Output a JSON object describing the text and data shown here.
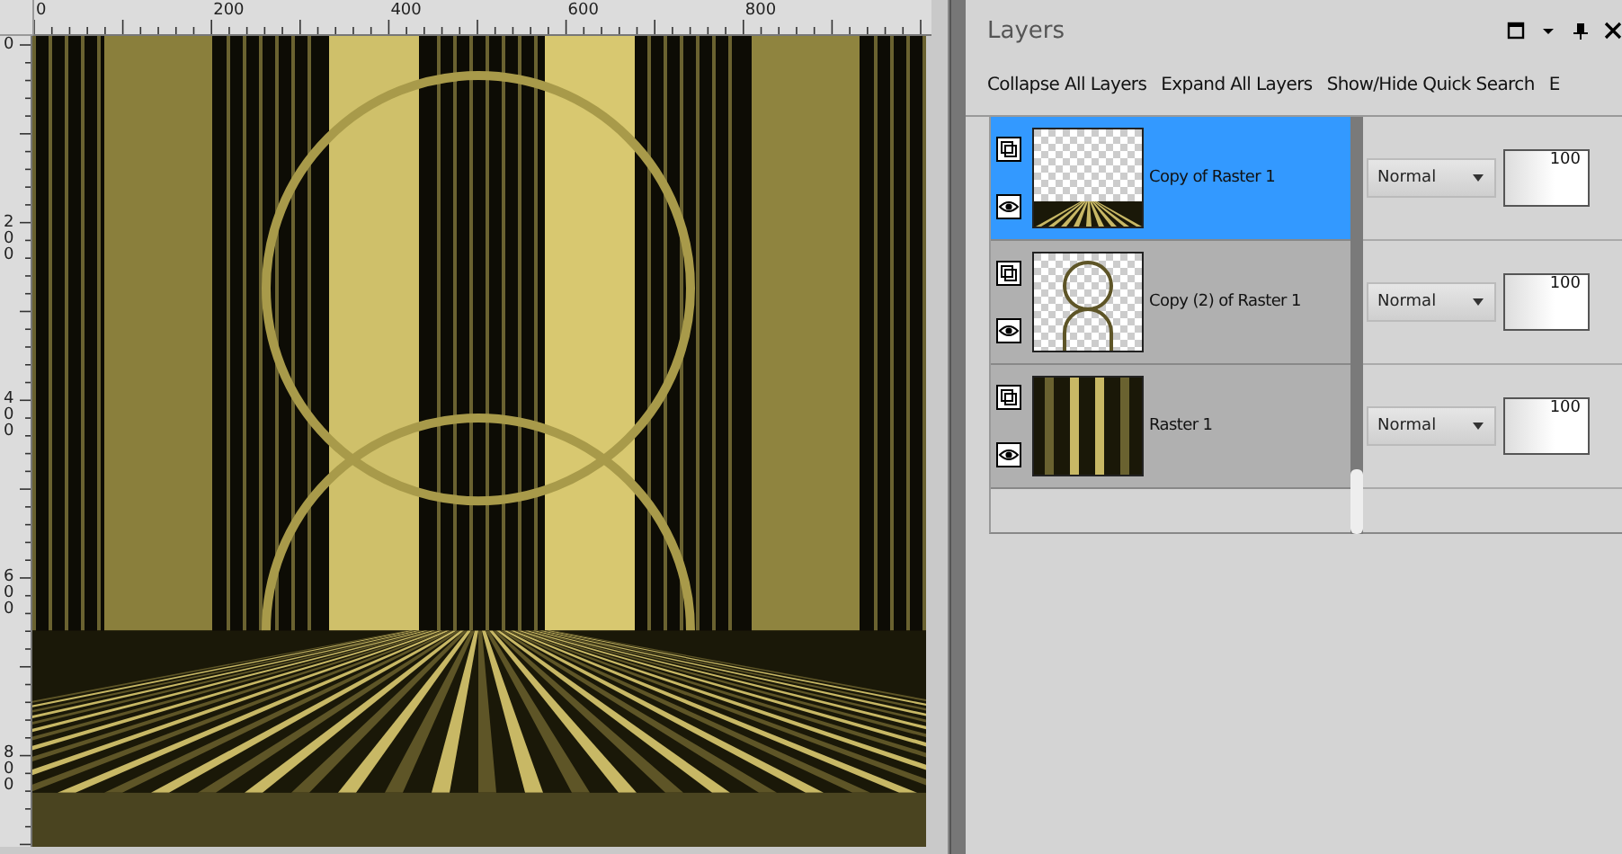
{
  "rulers": {
    "horizontal": [
      "0",
      "200",
      "400",
      "600",
      "800"
    ],
    "vertical": [
      "0",
      "200",
      "400",
      "600",
      "800"
    ]
  },
  "layers_panel": {
    "title": "Layers",
    "toolbar": [
      "Collapse All Layers",
      "Expand All Layers",
      "Show/Hide Quick Search",
      "E"
    ],
    "layers": [
      {
        "name": "Copy of Raster 1",
        "selected": true,
        "visible": true,
        "kind": "floor",
        "blend_mode": "Normal",
        "opacity": "100"
      },
      {
        "name": "Copy (2) of Raster 1",
        "selected": false,
        "visible": true,
        "kind": "rings",
        "blend_mode": "Normal",
        "opacity": "100"
      },
      {
        "name": "Raster 1",
        "selected": false,
        "visible": true,
        "kind": "stripes",
        "blend_mode": "Normal",
        "opacity": "100"
      }
    ]
  }
}
